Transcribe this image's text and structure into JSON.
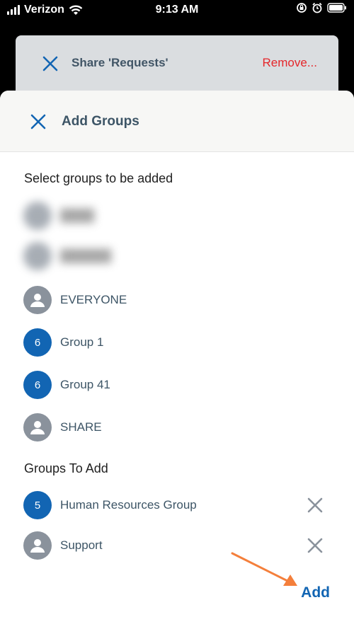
{
  "status_bar": {
    "carrier": "Verizon",
    "time": "9:13 AM"
  },
  "background_sheet": {
    "title": "Share 'Requests'",
    "remove_label": "Remove..."
  },
  "sheet": {
    "title": "Add Groups",
    "select_heading": "Select groups to be added",
    "groups_to_add_heading": "Groups To Add",
    "add_label": "Add"
  },
  "available_groups": [
    {
      "label": "EVERYONE",
      "count": "",
      "avatar": "person-icon"
    },
    {
      "label": "Group 1",
      "count": "6",
      "avatar": "count"
    },
    {
      "label": "Group 41",
      "count": "6",
      "avatar": "count"
    },
    {
      "label": "SHARE",
      "count": "",
      "avatar": "person-icon"
    }
  ],
  "groups_to_add": [
    {
      "label": "Human Resources Group",
      "count": "5",
      "avatar": "count"
    },
    {
      "label": "Support",
      "count": "",
      "avatar": "person-icon"
    }
  ],
  "colors": {
    "accent": "#1265b3",
    "remove": "#e5262a",
    "avatar_grey": "#8a929c",
    "annotation_arrow": "#f47f3b"
  }
}
